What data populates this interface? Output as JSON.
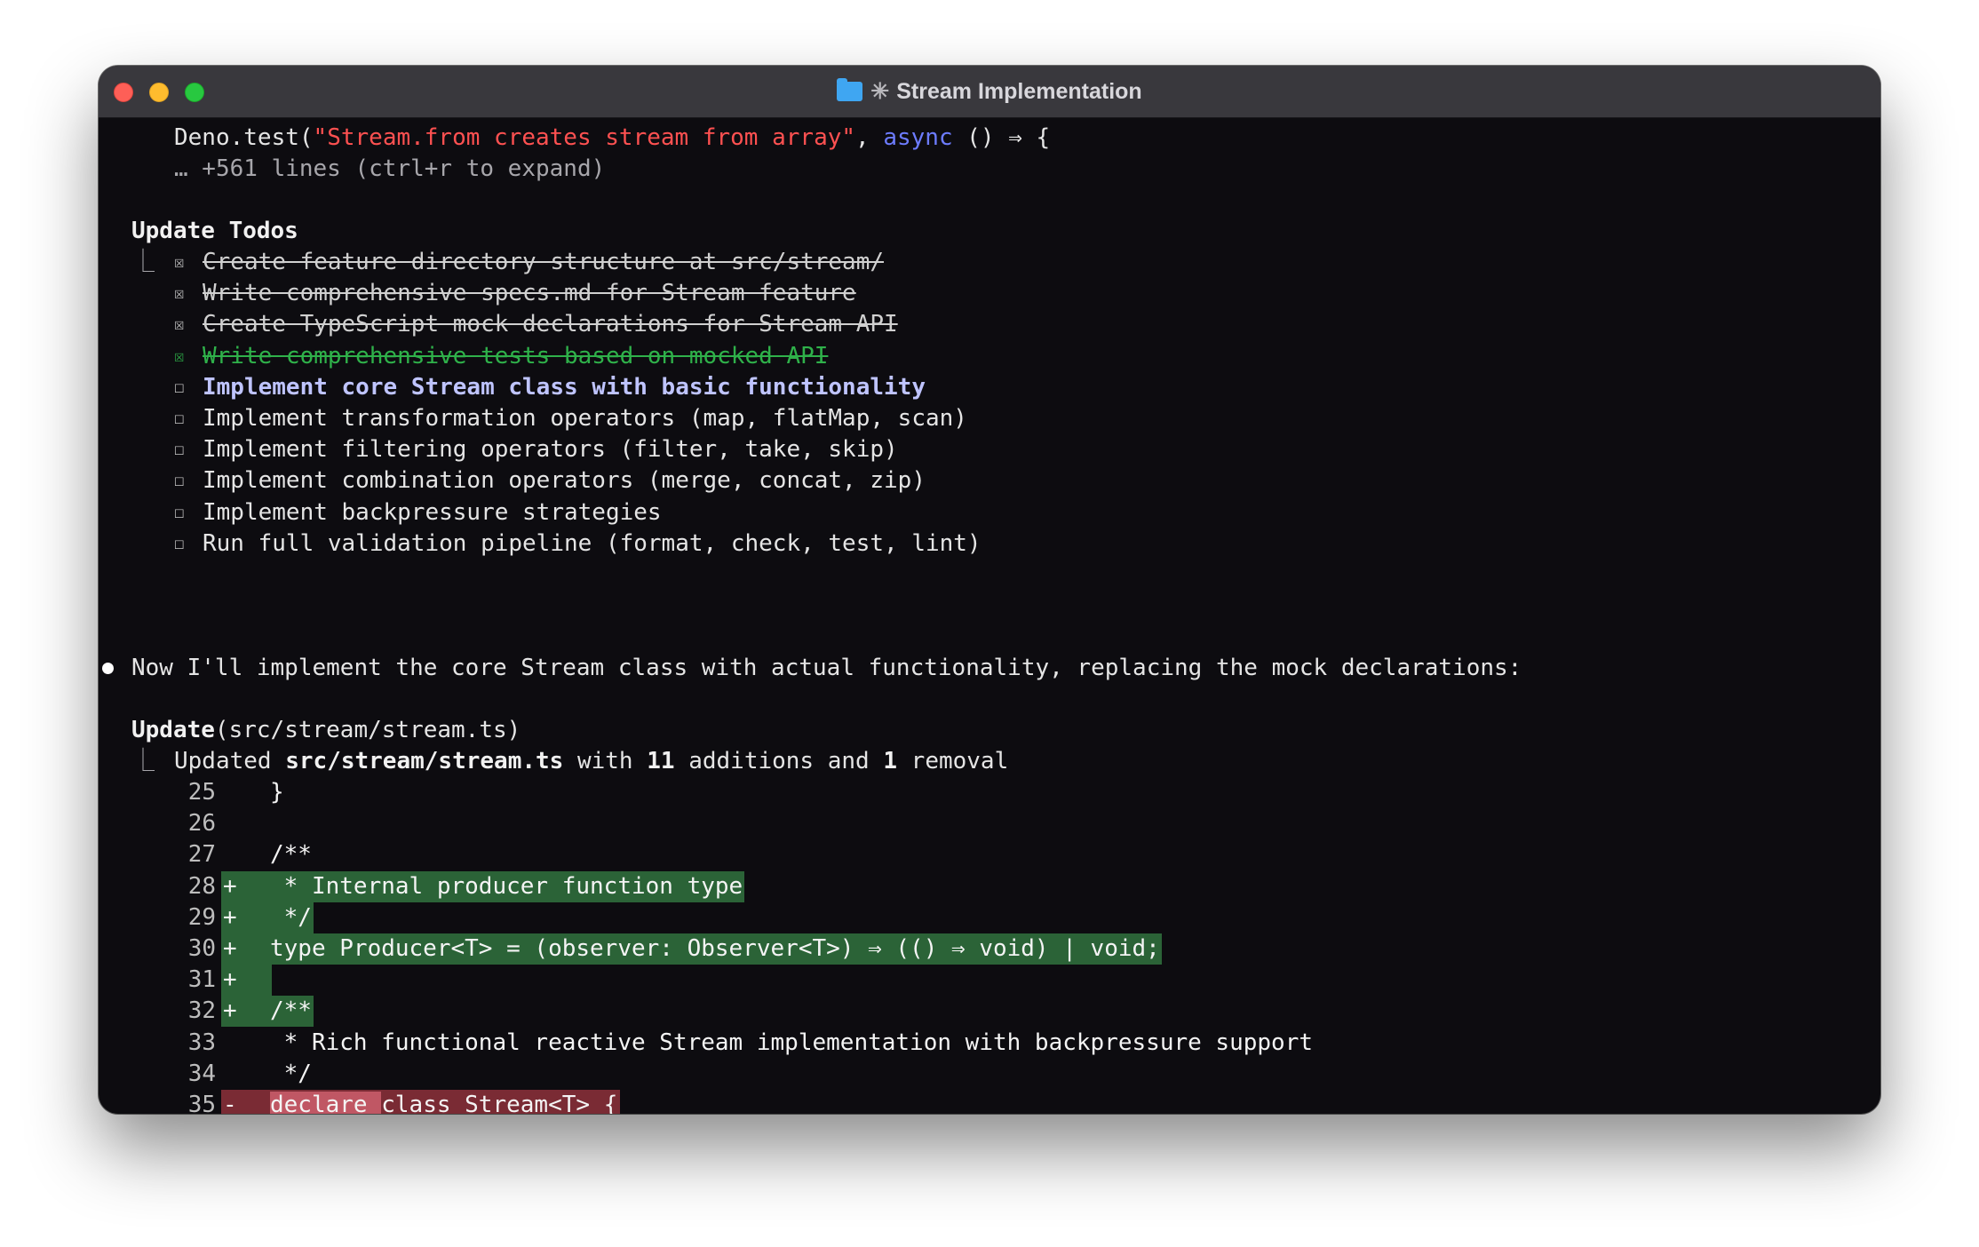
{
  "window": {
    "title": "Stream Implementation",
    "title_prefix_icon": "folder-icon",
    "activity_glyph": "✳"
  },
  "top": {
    "code_fn": "Deno.test(",
    "code_str": "\"Stream.from creates stream from array\"",
    "code_sep": ", ",
    "code_kw": "async",
    "code_tail": " () ⇒ {",
    "collapsed": "… +561 lines (ctrl+r to expand)"
  },
  "todos": {
    "heading": "Update Todos",
    "tree_glyph": "⎿",
    "checked_glyph": "☒",
    "unchecked_glyph": "☐",
    "items": [
      {
        "label": "Create feature directory structure at src/stream/",
        "status": "done"
      },
      {
        "label": "Write comprehensive specs.md for Stream feature",
        "status": "done"
      },
      {
        "label": "Create TypeScript mock declarations for Stream API",
        "status": "done"
      },
      {
        "label": "Write comprehensive tests based on mocked API",
        "status": "just-done"
      },
      {
        "label": "Implement core Stream class with basic functionality",
        "status": "in-progress"
      },
      {
        "label": "Implement transformation operators (map, flatMap, scan)",
        "status": "pending"
      },
      {
        "label": "Implement filtering operators (filter, take, skip)",
        "status": "pending"
      },
      {
        "label": "Implement combination operators (merge, concat, zip)",
        "status": "pending"
      },
      {
        "label": "Implement backpressure strategies",
        "status": "pending"
      },
      {
        "label": "Run full validation pipeline (format, check, test, lint)",
        "status": "pending"
      }
    ]
  },
  "message": "Now I'll implement the core Stream class with actual functionality, replacing the mock declarations:",
  "update": {
    "tool": "Update",
    "path_arg": "(src/stream/stream.ts)",
    "summary_prefix": "Updated ",
    "file": "src/stream/stream.ts",
    "with": " with ",
    "additions": "11",
    "additions_label": " additions and ",
    "removals": "1",
    "removals_label": " removal"
  },
  "diff": [
    {
      "num": "25",
      "sign": " ",
      "text": "}",
      "kind": "context",
      "indent": 2
    },
    {
      "num": "26",
      "sign": " ",
      "text": "",
      "kind": "context",
      "indent": 0
    },
    {
      "num": "27",
      "sign": " ",
      "text": "/**",
      "kind": "context",
      "indent": 2
    },
    {
      "num": "28",
      "sign": "+",
      "text": " * Internal producer function type",
      "kind": "add",
      "indent": 2
    },
    {
      "num": "29",
      "sign": "+",
      "text": " */",
      "kind": "add",
      "indent": 2
    },
    {
      "num": "30",
      "sign": "+",
      "text": "type Producer<T> = (observer: Observer<T>) ⇒ (() ⇒ void) | void;",
      "kind": "add",
      "indent": 2
    },
    {
      "num": "31",
      "sign": "+",
      "text": "",
      "kind": "add",
      "indent": 2
    },
    {
      "num": "32",
      "sign": "+",
      "text": "/**",
      "kind": "add",
      "indent": 2
    },
    {
      "num": "33",
      "sign": " ",
      "text": " * Rich functional reactive Stream implementation with backpressure support",
      "kind": "context",
      "indent": 2
    },
    {
      "num": "34",
      "sign": " ",
      "text": " */",
      "kind": "context",
      "indent": 2
    },
    {
      "num": "35",
      "sign": "-",
      "removed_word": "declare ",
      "text": "class Stream<T> {",
      "kind": "del",
      "indent": 2
    },
    {
      "num": "35",
      "sign": "+",
      "text": "class Stream<T> {",
      "kind": "add",
      "indent": 2
    }
  ]
}
